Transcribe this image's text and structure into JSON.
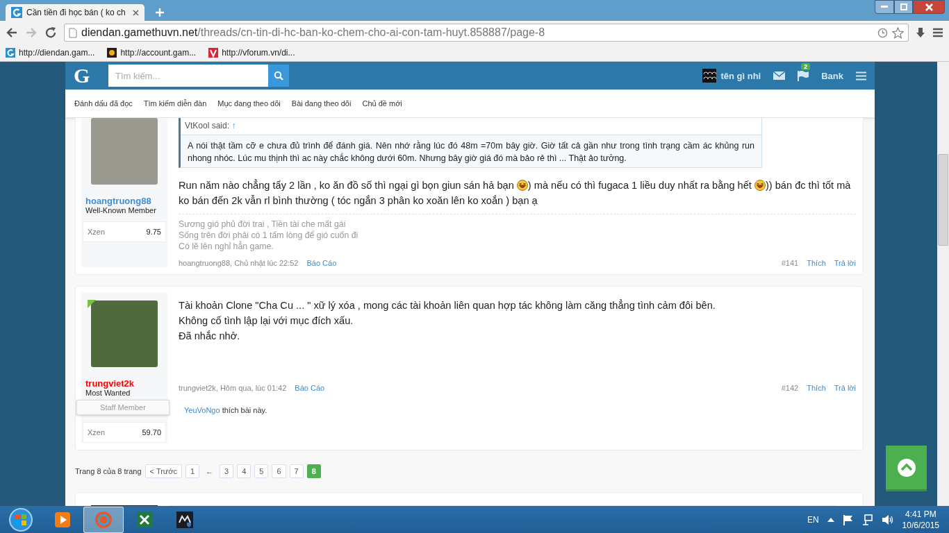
{
  "browser": {
    "tabs": [
      {
        "title": "Cần tiền đi học bán ( ko ch",
        "selected": true
      }
    ],
    "address": {
      "domain": "diendan.gamethuvn.net",
      "path": "/threads/cn-tin-di-hc-ban-ko-chem-cho-ai-con-tam-huyt.858887/page-8"
    },
    "bookmarks": [
      "http://diendan.gam...",
      "http://account.gam...",
      "http://vforum.vn/di..."
    ]
  },
  "site": {
    "logo": "G",
    "search": {
      "placeholder": "Tìm kiếm..."
    },
    "user": "tên gì nhỉ",
    "alerts_badge": "2",
    "bank": "Bank",
    "nav": [
      "Đánh dấu đã đọc",
      "Tìm kiếm diễn đàn",
      "Mục đang theo dõi",
      "Bài đang theo dõi",
      "Chủ đề mới"
    ]
  },
  "posts": [
    {
      "author": {
        "name": "hoangtruong88",
        "color": "#3d8fd6",
        "title": "Well-Known Member",
        "online": false,
        "stat_label": "Xzen",
        "stat_value": "9.75"
      },
      "quote": {
        "author": "VtKool said:",
        "arrow": "↑",
        "text": "A nói thật tầm cỡ e chưa đủ trình để đánh giá. Nên nhớ rằng lúc đó 48m =70m bây giờ. Giờ tất cả gần như trong tình trạng cầm ác khủng run nhong nhóc. Lúc mu thịnh thì ac này chắc không dưới 60m. Nhưng bây giờ giá đó mà bảo rẻ thì ... Thật ảo tưởng."
      },
      "body": [
        [
          {
            "kind": "text",
            "text": "Run năm nào chẳng tẩy 2 lần , ko ăn đồ số thì ngại gì bọn giun sán hả bạn "
          },
          {
            "kind": "smiley"
          },
          {
            "kind": "text",
            "text": ") mà nếu có thì fugaca 1 liều duy nhất ra bằng hết "
          },
          {
            "kind": "smiley"
          },
          {
            "kind": "text",
            "text": ")) bán đc thì tốt mà"
          }
        ],
        [
          {
            "kind": "text",
            "text": "ko bán đến 2k vẫn rl bình thường ( tóc ngắn 3 phân ko xoăn lên ko xoắn ) bạn ạ"
          }
        ]
      ],
      "signature": [
        "Sương gió phủ đời trai , Tiền tài che mất gái",
        "Sống trên đời phải có 1 tấm lòng để gió cuốn đi",
        "Có lẽ lên nghỉ hẳn game."
      ],
      "meta": "hoangtruong88, Chủ nhật lúc 22:52",
      "report": "Báo Cáo",
      "number": "#141",
      "like": "Thích",
      "reply": "Trả lời"
    },
    {
      "author": {
        "name": "trungviet2k",
        "color": "#ff0000",
        "title": "Most Wanted",
        "online": true,
        "staff": "Staff Member",
        "stat_label": "Xzen",
        "stat_value": "59.70"
      },
      "body": [
        [
          {
            "kind": "text",
            "text": "Tài khoản Clone \"Cha Cu ... \" xữ lý xóa , mong các tài khoản liên quan hợp tác không làm căng thẳng tình cảm đôi bên."
          }
        ],
        [
          {
            "kind": "text",
            "text": "Không cố tình lập lại với mục đích xấu."
          }
        ],
        [
          {
            "kind": "text",
            "text": "Đã nhắc nhở."
          }
        ]
      ],
      "meta": "trungviet2k, Hôm qua, lúc 01:42",
      "report": "Báo Cáo",
      "number": "#142",
      "like": "Thích",
      "reply": "Trả lời",
      "likes": {
        "user": "YeuVoNgo",
        "text": "thích bài này."
      }
    }
  ],
  "pagination": {
    "label": "Trang 8 của 8 trang",
    "prev": "< Trước",
    "pages": [
      {
        "kind": "page",
        "label": "1",
        "selected": false
      },
      {
        "kind": "gap",
        "label": "←"
      },
      {
        "kind": "page",
        "label": "3",
        "selected": false
      },
      {
        "kind": "page",
        "label": "4",
        "selected": false
      },
      {
        "kind": "page",
        "label": "5",
        "selected": false
      },
      {
        "kind": "page",
        "label": "6",
        "selected": false
      },
      {
        "kind": "page",
        "label": "7",
        "selected": false
      },
      {
        "kind": "page",
        "label": "8",
        "selected": true
      }
    ]
  },
  "taskbar": {
    "items": [
      {
        "kind": "media",
        "selected": false
      },
      {
        "kind": "browser",
        "selected": true
      },
      {
        "kind": "spreadsheet",
        "selected": false
      },
      {
        "kind": "game",
        "selected": false
      }
    ],
    "language": "EN",
    "time": "4:41 PM",
    "date": "10/6/2015"
  }
}
